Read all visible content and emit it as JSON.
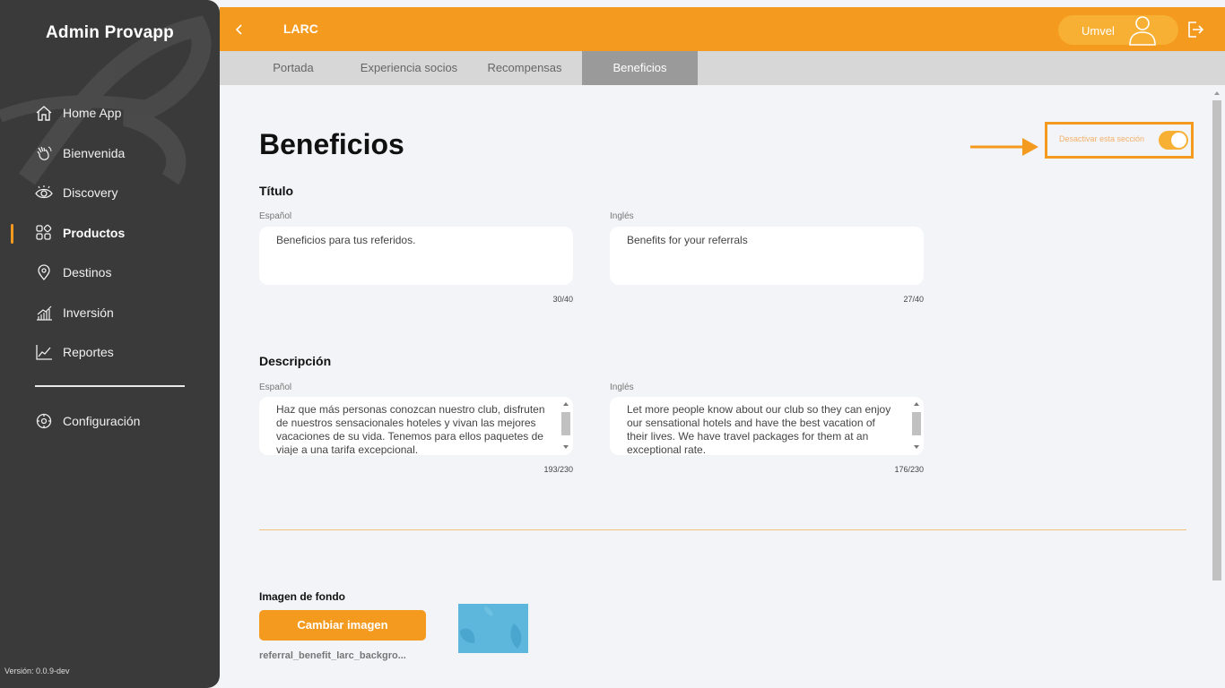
{
  "sidebar": {
    "brand": "Admin Provapp",
    "items": [
      {
        "label": "Home App",
        "icon": "home-icon"
      },
      {
        "label": "Bienvenida",
        "icon": "waving-hand-icon"
      },
      {
        "label": "Discovery",
        "icon": "eye-icon"
      },
      {
        "label": "Productos",
        "icon": "grid-icon",
        "active": true
      },
      {
        "label": "Destinos",
        "icon": "location-pin-icon"
      },
      {
        "label": "Inversión",
        "icon": "bar-chart-icon"
      },
      {
        "label": "Reportes",
        "icon": "line-chart-icon"
      }
    ],
    "settings": {
      "label": "Configuración",
      "icon": "gear-icon"
    },
    "version": "Versión: 0.0.9-dev"
  },
  "header": {
    "title": "LARC",
    "user_name": "Umvel"
  },
  "tabs": [
    {
      "label": "Portada"
    },
    {
      "label": "Experiencia socios"
    },
    {
      "label": "Recompensas"
    },
    {
      "label": "Beneficios",
      "active": true
    }
  ],
  "main": {
    "title": "Beneficios",
    "toggle_label": "Desactivar esta sección",
    "toggle_on": true,
    "titulo": {
      "heading": "Título",
      "es_label": "Español",
      "es_value": "Beneficios para tus referidos.",
      "es_count": "30/40",
      "en_label": "Inglés",
      "en_value": "Benefits for your referrals",
      "en_count": "27/40"
    },
    "descripcion": {
      "heading": "Descripción",
      "es_label": "Español",
      "es_value": "Haz que más personas conozcan nuestro club, disfruten de nuestros sensacionales hoteles y vivan las mejores vacaciones de su vida. Tenemos para ellos paquetes de viaje a una tarifa excepcional.",
      "es_count": "193/230",
      "en_label": "Inglés",
      "en_value": "Let more people know about our club so they can enjoy our sensational hotels and have the best vacation of their lives. We have travel packages for them at an exceptional rate.",
      "en_count": "176/230"
    },
    "image": {
      "label": "Imagen de fondo",
      "button": "Cambiar imagen",
      "file_name": "referral_benefit_larc_backgro..."
    }
  },
  "colors": {
    "accent": "#f39a1f",
    "sidebar_bg": "#3a3a3a",
    "tab_bar": "#d7d7d7",
    "tab_active": "#9a9a9a"
  }
}
